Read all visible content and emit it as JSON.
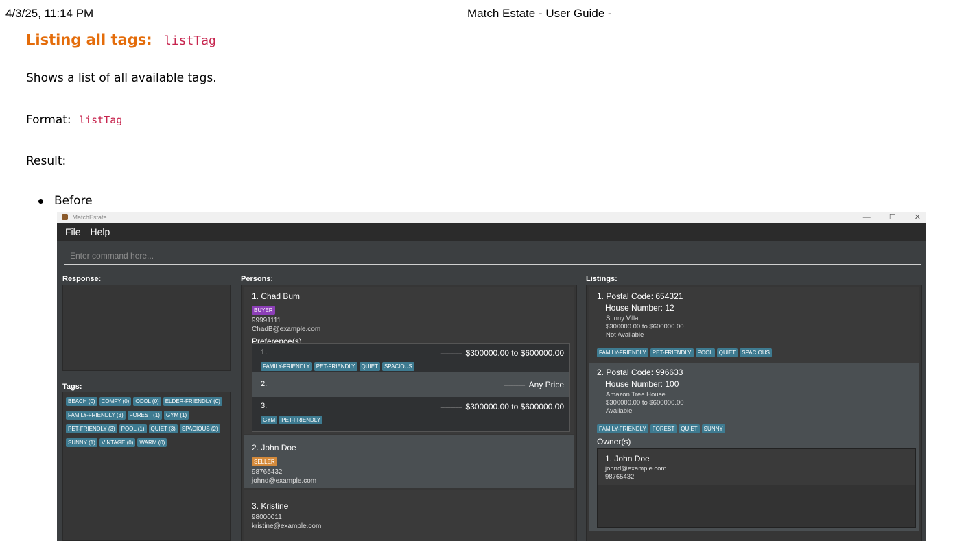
{
  "print": {
    "date": "4/3/25, 11:14 PM",
    "title": "Match Estate - User Guide -"
  },
  "doc": {
    "heading": "Listing all tags:",
    "heading_cmd": "listTag",
    "description": "Shows a list of all available tags.",
    "format_label": "Format:",
    "format_cmd": "listTag",
    "result_label": "Result:",
    "bullet": "Before"
  },
  "app": {
    "window_title": "MatchEstate",
    "win_ctrls": [
      "—",
      "☐",
      "✕"
    ],
    "menu": [
      "File",
      "Help"
    ],
    "command_placeholder": "Enter command here...",
    "response_label": "Response:",
    "tags_label": "Tags:",
    "persons_label": "Persons:",
    "listings_label": "Listings:",
    "tags": [
      "BEACH (0)",
      "COMFY (0)",
      "COOL (0)",
      "ELDER-FRIENDLY (0)",
      "FAMILY-FRIENDLY (3)",
      "FOREST (1)",
      "GYM (1)",
      "PET-FRIENDLY (3)",
      "POOL (1)",
      "QUIET (3)",
      "SPACIOUS (2)",
      "SUNNY (1)",
      "VINTAGE (0)",
      "WARM (0)"
    ],
    "persons": [
      {
        "name": "1. Chad Bum",
        "role": "BUYER",
        "phone": "99991111",
        "email": "ChadB@example.com",
        "pref_label": "Preference(s)",
        "prefs": [
          {
            "num": "1.",
            "dashes": "-------------",
            "price": "$300000.00 to $600000.00",
            "tags": [
              "FAMILY-FRIENDLY",
              "PET-FRIENDLY",
              "QUIET",
              "SPACIOUS"
            ]
          },
          {
            "num": "2.",
            "dashes": "-------------",
            "price": "Any Price",
            "tags": []
          },
          {
            "num": "3.",
            "dashes": "-------------",
            "price": "$300000.00 to $600000.00",
            "tags": [
              "GYM",
              "PET-FRIENDLY"
            ]
          }
        ]
      },
      {
        "name": "2. John Doe",
        "role": "SELLER",
        "phone": "98765432",
        "email": "johnd@example.com"
      },
      {
        "name": "3. Kristine",
        "phone": "98000011",
        "email": "kristine@example.com"
      }
    ],
    "listings": [
      {
        "postal": "1. Postal Code: 654321",
        "house": "House Number: 12",
        "name": "Sunny Villa",
        "price": "$300000.00 to $600000.00",
        "status": "Not Available",
        "tags": [
          "FAMILY-FRIENDLY",
          "PET-FRIENDLY",
          "POOL",
          "QUIET",
          "SPACIOUS"
        ]
      },
      {
        "postal": "2. Postal Code: 996633",
        "house": "House Number: 100",
        "name": "Amazon Tree House",
        "price": "$300000.00 to $600000.00",
        "status": "Available",
        "tags": [
          "FAMILY-FRIENDLY",
          "FOREST",
          "QUIET",
          "SUNNY"
        ],
        "owner_label": "Owner(s)",
        "owner": {
          "name": "1. John Doe",
          "email": "johnd@example.com",
          "phone": "98765432"
        }
      }
    ]
  },
  "colors": {
    "accent_heading": "#e46c0a",
    "code": "#c7254e",
    "tag_bg": "#3e7b91",
    "buyer": "#8c3fb7",
    "seller": "#d48a3b",
    "app_bg": "#3c3f41"
  }
}
